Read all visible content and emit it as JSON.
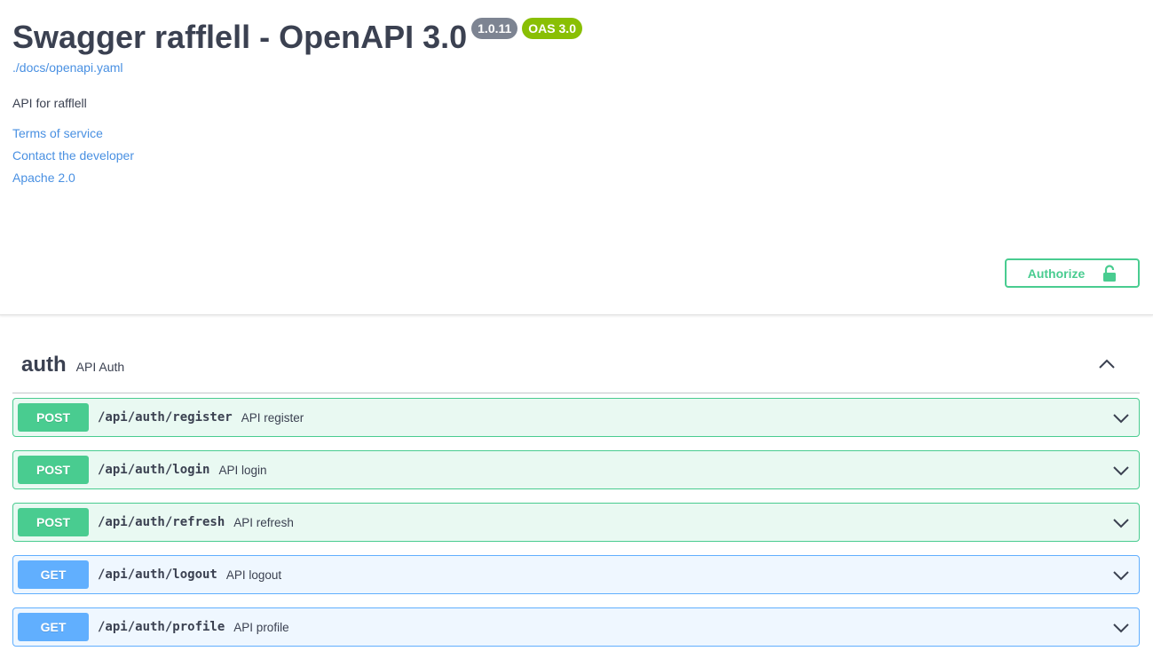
{
  "info": {
    "title": "Swagger rafflell - OpenAPI 3.0",
    "version_badge": "1.0.11",
    "oas_badge": "OAS 3.0",
    "spec_url": "./docs/openapi.yaml",
    "description": "API for rafflell",
    "terms_label": "Terms of service",
    "contact_label": "Contact the developer",
    "license_label": "Apache 2.0"
  },
  "authorize": {
    "label": "Authorize",
    "icon": "unlocked-lock-icon"
  },
  "tag": {
    "name": "auth",
    "description": "API Auth",
    "expanded": true
  },
  "operations": [
    {
      "method": "POST",
      "path": "/api/auth/register",
      "summary": "API register"
    },
    {
      "method": "POST",
      "path": "/api/auth/login",
      "summary": "API login"
    },
    {
      "method": "POST",
      "path": "/api/auth/refresh",
      "summary": "API refresh"
    },
    {
      "method": "GET",
      "path": "/api/auth/logout",
      "summary": "API logout"
    },
    {
      "method": "GET",
      "path": "/api/auth/profile",
      "summary": "API profile"
    }
  ],
  "colors": {
    "post": "#49cc90",
    "get": "#61affe",
    "link": "#4990e2",
    "version_badge": "#7d8492",
    "oas_badge": "#89bf04"
  }
}
